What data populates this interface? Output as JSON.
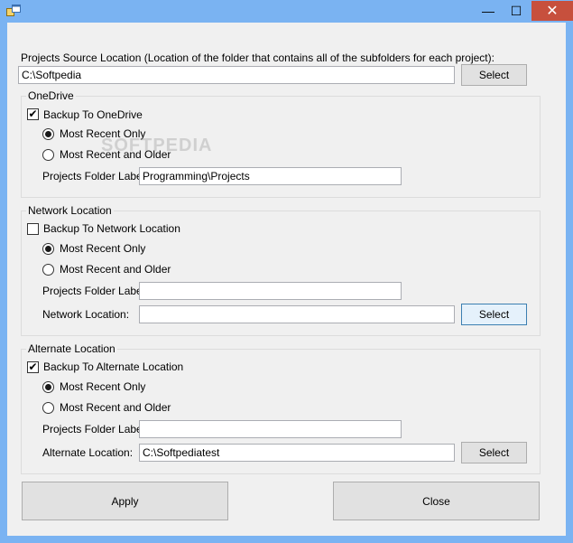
{
  "window": {
    "title": "",
    "minimize_glyph": "—",
    "maximize_glyph": "☐",
    "close_glyph": "✕"
  },
  "source": {
    "label": "Projects Source Location (Location of the folder that contains all of the subfolders for each project):",
    "value": "C:\\Softpedia",
    "select_label": "Select"
  },
  "onedrive": {
    "group_title": "OneDrive",
    "backup_label": "Backup To OneDrive",
    "backup_checked": true,
    "radio_recent": "Most Recent Only",
    "radio_older": "Most Recent and Older",
    "selected_radio": "recent",
    "folder_label": "Projects Folder Label:",
    "folder_value": "Programming\\Projects",
    "watermark": "SOFTPEDIA"
  },
  "network": {
    "group_title": "Network Location",
    "backup_label": "Backup To Network Location",
    "backup_checked": false,
    "radio_recent": "Most Recent Only",
    "radio_older": "Most Recent and Older",
    "selected_radio": "recent",
    "folder_label": "Projects Folder Label:",
    "folder_value": "",
    "location_label": "Network Location:",
    "location_value": "",
    "select_label": "Select"
  },
  "alternate": {
    "group_title": "Alternate Location",
    "backup_label": "Backup To Alternate Location",
    "backup_checked": true,
    "radio_recent": "Most Recent Only",
    "radio_older": "Most Recent and Older",
    "selected_radio": "recent",
    "folder_label": "Projects Folder Label:",
    "folder_value": "",
    "location_label": "Alternate Location:",
    "location_value": "C:\\Softpediatest",
    "select_label": "Select"
  },
  "footer": {
    "apply_label": "Apply",
    "close_label": "Close"
  },
  "icons": {
    "app": "app-window-icon",
    "check": "✔"
  }
}
